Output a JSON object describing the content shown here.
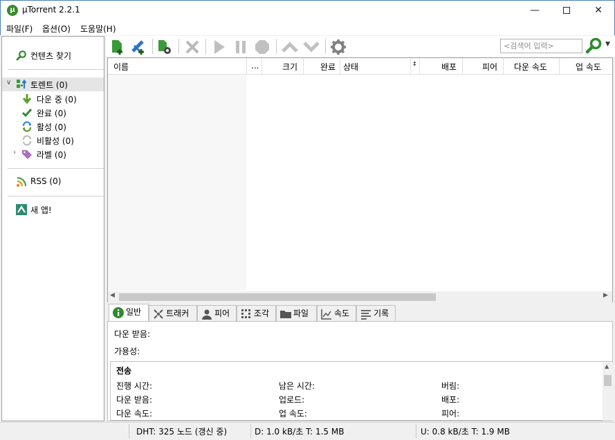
{
  "window": {
    "title": "µTorrent 2.2.1",
    "app_icon_glyph": "µ",
    "minimize_glyph": "—",
    "close_glyph": "✕"
  },
  "menu": [
    {
      "label": "파일(F)"
    },
    {
      "label": "옵션(O)"
    },
    {
      "label": "도움말(H)"
    }
  ],
  "sidebar": {
    "find_content": "컨텐츠 찾기",
    "items": [
      {
        "label": "토렌트 (0)",
        "icon": "torrents-icon"
      },
      {
        "label": "다운 중 (0)",
        "icon": "download-arrow-icon"
      },
      {
        "label": "완료 (0)",
        "icon": "checkmark-icon"
      },
      {
        "label": "활성 (0)",
        "icon": "active-arrows-icon"
      },
      {
        "label": "비활성 (0)",
        "icon": "inactive-arrows-icon"
      },
      {
        "label": "라벨 (0)",
        "icon": "label-tag-icon"
      }
    ],
    "rss": "RSS (0)",
    "new_app": "새 앱!"
  },
  "toolbar": {
    "search_placeholder": "<검색어 입력>"
  },
  "list": {
    "columns": [
      {
        "label": "이름"
      },
      {
        "label": "..."
      },
      {
        "label": "크기"
      },
      {
        "label": "완료"
      },
      {
        "label": "상태"
      },
      {
        "label": "‡"
      },
      {
        "label": "배포"
      },
      {
        "label": "피어"
      },
      {
        "label": "다운 속도"
      },
      {
        "label": "업 속도"
      }
    ]
  },
  "tabs": [
    {
      "label": "일반"
    },
    {
      "label": "트래커"
    },
    {
      "label": "피어"
    },
    {
      "label": "조각"
    },
    {
      "label": "파일"
    },
    {
      "label": "속도"
    },
    {
      "label": "기록"
    }
  ],
  "detail": {
    "downloaded": "다운 받음:",
    "availability": "가용성:",
    "transfer_title": "전송",
    "fields": [
      [
        "진행 시간:",
        "남은 시간:",
        "버림:"
      ],
      [
        "다운 받음:",
        "업로드:",
        "배포:"
      ],
      [
        "다운 속도:",
        "업 속도:",
        "피어:"
      ]
    ]
  },
  "status": {
    "dht": "DHT: 325 노드  (갱신 중)",
    "down": "D: 1.0 kB/초 T: 1.5 MB",
    "up": "U: 0.8 kB/초 T: 1.9 MB"
  },
  "colors": {
    "accent_green": "#2e8b2e",
    "window_border": "#4a7fb5"
  }
}
